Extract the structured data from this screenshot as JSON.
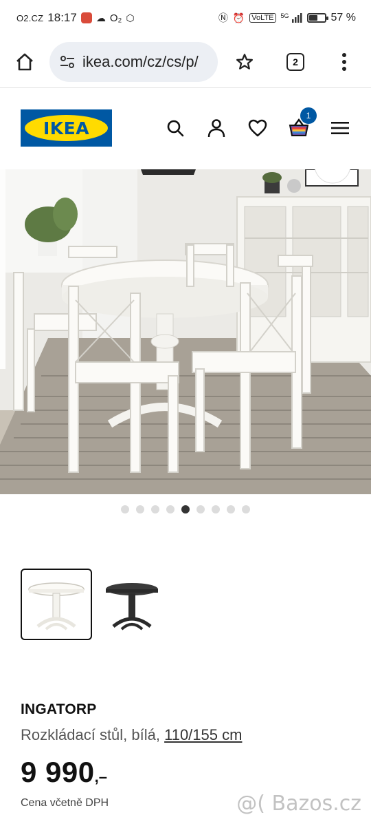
{
  "status_bar": {
    "carrier": "O2.CZ",
    "time": "18:17",
    "battery_percent": "57 %",
    "battery_level": 0.57,
    "network_label": "VoLTE",
    "net_type": "5G"
  },
  "browser": {
    "url": "ikea.com/cz/cs/p/",
    "tab_count": "2",
    "icons": [
      "home-icon",
      "site-settings-icon",
      "star-icon",
      "tabs-icon",
      "more-vert-icon"
    ]
  },
  "header": {
    "logo_text": "IKEA",
    "cart_count": "1",
    "icons": [
      "search-icon",
      "account-icon",
      "heart-icon",
      "cart-icon",
      "menu-icon"
    ],
    "brand_colors": {
      "blue": "#0058a3",
      "yellow": "#ffdb00"
    }
  },
  "carousel": {
    "dot_count": 9,
    "active_index": 4
  },
  "variants": [
    {
      "name": "white",
      "selected": true
    },
    {
      "name": "black",
      "selected": false
    }
  ],
  "product": {
    "name": "INGATORP",
    "description": "Rozkládací stůl, bílá,",
    "size": "110/155 cm",
    "price": "9 990",
    "price_suffix": ",–",
    "vat_note": "Cena včetně DPH"
  },
  "watermark": "@( Bazos.cz"
}
